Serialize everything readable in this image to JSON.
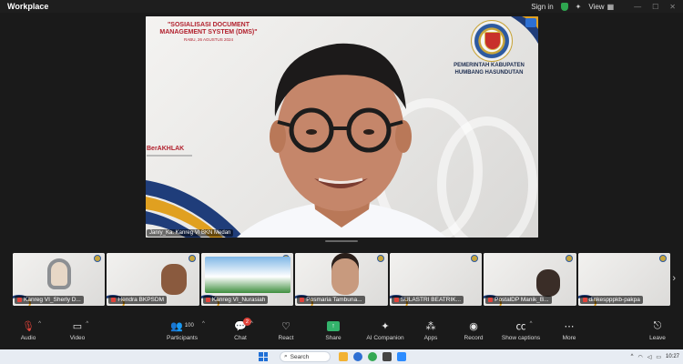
{
  "app": {
    "title": "Workplace"
  },
  "topbar": {
    "sign_in": "Sign in",
    "view": "View"
  },
  "slide": {
    "title": "\"SOSIALISASI DOCUMENT MANAGEMENT SYSTEM (DMS)\"",
    "date": "RABU, 26 AGUSTUS 2024",
    "gov_name": "PEMERINTAH KABUPATEN HUMBANG HASUNDUTAN",
    "berakhlak": "BerAKHLAK"
  },
  "speaker": {
    "name": "Janry_Ka. Kanreg VI BKN Medan"
  },
  "gallery": [
    {
      "name": "Kanreg VI_Sherly D...",
      "muted": true
    },
    {
      "name": "Hendra BKPSDM",
      "muted": true
    },
    {
      "name": "Kanreg VI_Nurasiah",
      "muted": true
    },
    {
      "name": "Posmaria Tambuna...",
      "muted": true
    },
    {
      "name": "SULASTRI BEATRIK...",
      "muted": true
    },
    {
      "name": "PostalDP Manik_B...",
      "muted": true
    },
    {
      "name": "dinkespppkb-pakpa",
      "muted": true
    }
  ],
  "toolbar": {
    "audio": "Audio",
    "video": "Video",
    "participants": "Participants",
    "participants_count": "100",
    "chat": "Chat",
    "chat_badge": "2",
    "react": "React",
    "share": "Share",
    "ai_companion": "AI Companion",
    "apps": "Apps",
    "record": "Record",
    "captions": "Show captions",
    "more": "More",
    "leave": "Leave"
  },
  "taskbar": {
    "search": "Search",
    "time": "10:27"
  },
  "colors": {
    "accent_red": "#b11f2c",
    "share_green": "#33b36b",
    "leave_red": "#e0433a"
  }
}
